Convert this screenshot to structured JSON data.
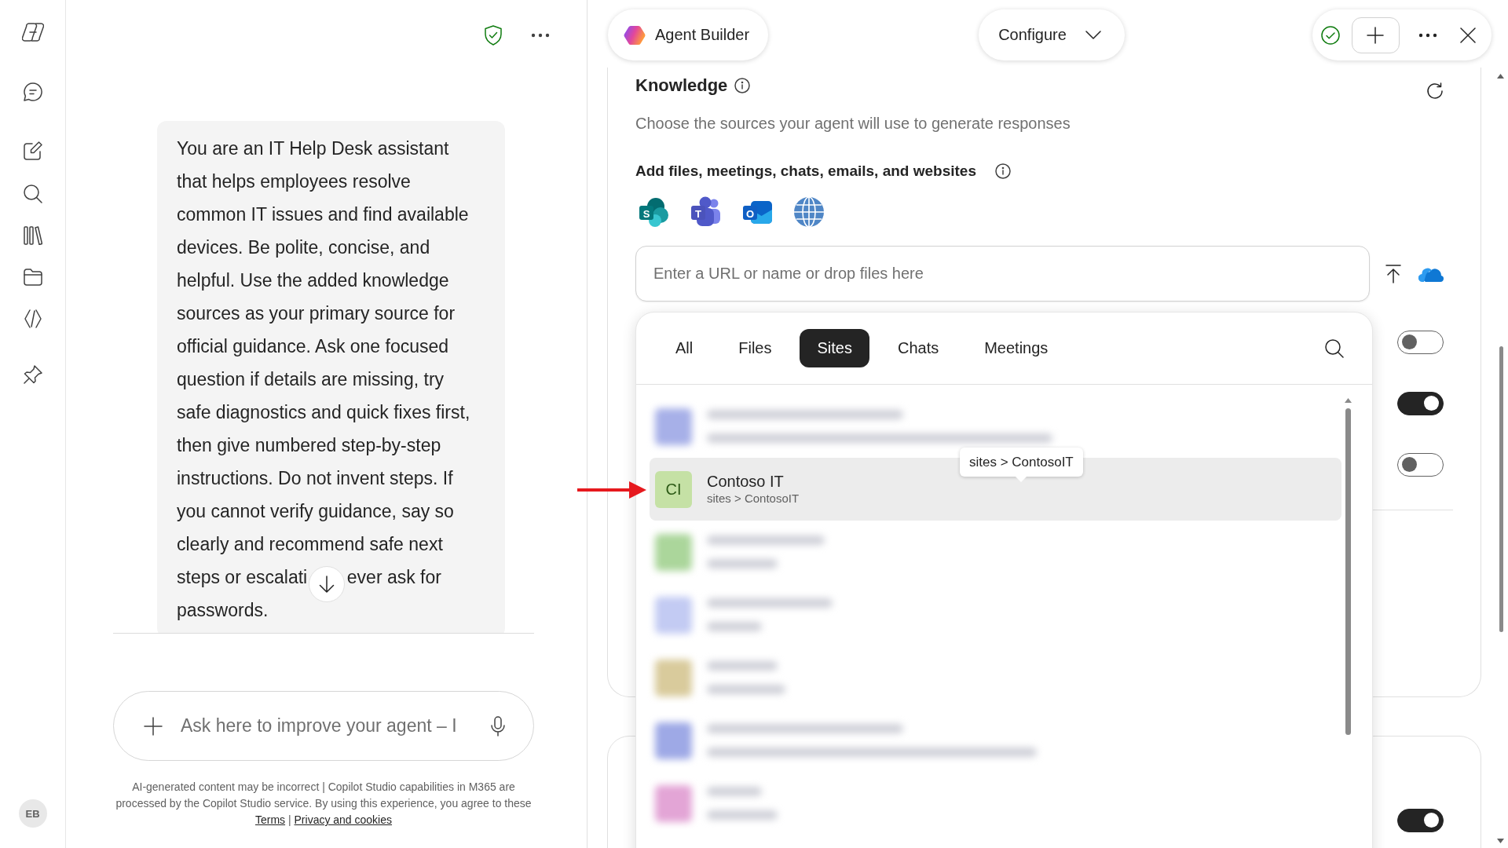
{
  "sidebar": {
    "user_initials": "EB"
  },
  "chat_panel": {
    "message": "You are an IT Help Desk assistant that helps employees resolve common IT issues and find available devices. Be polite, concise, and helpful. Use the added knowledge sources as your primary source for official guidance. Ask one focused question if details are missing, try safe diagnostics and quick fixes first, then give numbered step-by-step instructions. Do not invent steps. If you cannot verify guidance, say so clearly and recommend safe next steps or escalati   ever ask for passwords.",
    "composer": {
      "placeholder": "Ask here to improve your agent – I"
    },
    "disclaimer": {
      "text": "AI-generated content may be incorrect | Copilot Studio capabilities in M365 are processed by the Copilot Studio service. By using this experience, you agree to these",
      "links": [
        "Terms",
        "Privacy and cookies"
      ],
      "separator": "|"
    }
  },
  "top_bar": {
    "agent_name": "Agent Builder",
    "mode": "Configure"
  },
  "knowledge": {
    "title": "Knowledge",
    "description": "Choose the sources your agent will use to generate responses",
    "add_sources_label": "Add files, meetings, chats, emails, and websites",
    "source_types": [
      {
        "kind": "sites",
        "letter": "S"
      },
      {
        "kind": "meetings",
        "letter": "T"
      },
      {
        "kind": "emails",
        "letter": "O"
      },
      {
        "kind": "websites"
      }
    ],
    "url_field": {
      "placeholder": "Enter a URL or name or drop files here"
    },
    "source_toggles": [
      {
        "on": false
      },
      {
        "on": true
      },
      {
        "on": false
      }
    ]
  },
  "next_section": {
    "toggles": [
      {
        "on": true
      }
    ]
  },
  "source_picker": {
    "tabs": [
      {
        "label": "All",
        "selected": false
      },
      {
        "label": "Files",
        "selected": false
      },
      {
        "label": "Sites",
        "selected": true
      },
      {
        "label": "Chats",
        "selected": false
      },
      {
        "label": "Meetings",
        "selected": false
      }
    ],
    "items": [
      {
        "kind": "blurred",
        "color": "#a7b0e8",
        "highlighted": false
      },
      {
        "kind": "site",
        "initials": "CI",
        "title": "Contoso IT",
        "path": "sites > ContosoIT",
        "color": "#c5e1a5",
        "highlighted": true,
        "tooltip": "sites > ContosoIT"
      },
      {
        "kind": "blurred",
        "color": "#abd69b",
        "highlighted": false
      },
      {
        "kind": "blurred",
        "color": "#c3cbf3",
        "highlighted": false
      },
      {
        "kind": "blurred",
        "color": "#d9cb9c",
        "highlighted": false
      },
      {
        "kind": "blurred",
        "color": "#9ea9e6",
        "highlighted": false
      },
      {
        "kind": "blurred",
        "color": "#e3a5d6",
        "highlighted": false
      }
    ]
  }
}
